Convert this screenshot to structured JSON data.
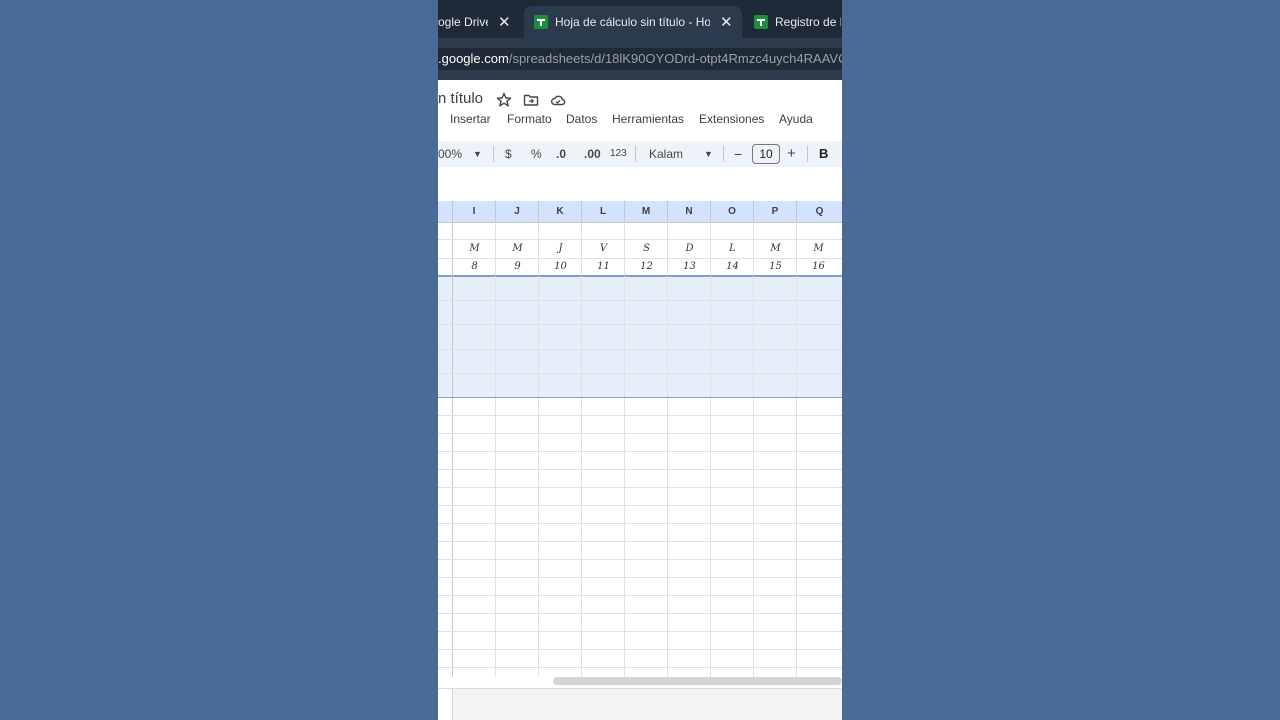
{
  "browser": {
    "tabs": [
      {
        "title": "ogle Drive",
        "has_sheets_icon": false,
        "active": false
      },
      {
        "title": "Hoja de cálculo sin título - Hoja",
        "has_sheets_icon": true,
        "active": true
      },
      {
        "title": "Registro de h",
        "has_sheets_icon": true,
        "active": false
      }
    ],
    "close_glyph": "✕",
    "url": {
      "host": ".google.com",
      "path": "/spreadsheets/d/18lK90OYODrd-otpt4Rmzc4uych4RAAVC"
    }
  },
  "doc": {
    "title": "n título",
    "header_icons": [
      "star-icon",
      "move-to-folder-icon",
      "cloud-saved-icon"
    ]
  },
  "menubar": {
    "items": [
      "Insertar",
      "Formato",
      "Datos",
      "Herramientas",
      "Extensiones",
      "Ayuda"
    ]
  },
  "toolbar": {
    "zoom": "00%",
    "currency": "$",
    "percent": "%",
    "decrease_decimals": ".0",
    "increase_decimals": ".00",
    "number_format": "123",
    "font": "Kalam",
    "font_size_minus": "−",
    "font_size": "10",
    "font_size_plus": "+",
    "bold": "B"
  },
  "sheet": {
    "columns": [
      "I",
      "J",
      "K",
      "L",
      "M",
      "N",
      "O",
      "P",
      "Q"
    ],
    "weekdays": [
      "M",
      "M",
      "J",
      "V",
      "S",
      "D",
      "L",
      "M",
      "M"
    ],
    "days": [
      "8",
      "9",
      "10",
      "11",
      "12",
      "13",
      "14",
      "15",
      "16"
    ]
  },
  "colors": {
    "page_bg": "#4a6a98",
    "selection": "#e6eef9",
    "header_blue": "#d3e3fd",
    "sheets_green": "#1e8e3e"
  }
}
